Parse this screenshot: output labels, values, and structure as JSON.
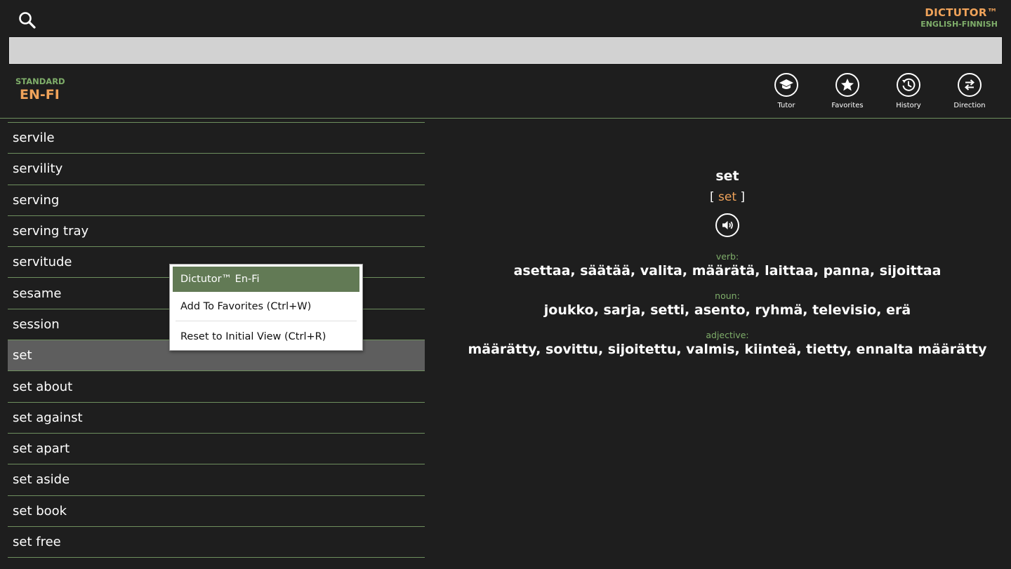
{
  "header": {
    "brand_name": "DICTUTOR™",
    "brand_sub": "ENGLISH-FINNISH",
    "search": {
      "value": "",
      "placeholder": ""
    },
    "mode_label": "STANDARD",
    "mode_value": "EN-FI"
  },
  "toolbar": [
    {
      "label": "Tutor",
      "icon": "graduation-cap-icon"
    },
    {
      "label": "Favorites",
      "icon": "star-icon"
    },
    {
      "label": "History",
      "icon": "clock-history-icon"
    },
    {
      "label": "Direction",
      "icon": "swap-arrows-icon"
    }
  ],
  "word_list": [
    "servile",
    "servility",
    "serving",
    "serving tray",
    "servitude",
    "sesame",
    "session",
    "set",
    "set about",
    "set against",
    "set apart",
    "set aside",
    "set book",
    "set free"
  ],
  "selected_word": "set",
  "entry": {
    "headword": "set",
    "pron_open": "[",
    "pron": "set",
    "pron_close": "]",
    "senses": [
      {
        "pos": "verb:",
        "translations": "asettaa, säätää, valita, määrätä, laittaa, panna, sijoittaa"
      },
      {
        "pos": "noun:",
        "translations": "joukko, sarja, setti, asento, ryhmä, televisio, erä"
      },
      {
        "pos": "adjective:",
        "translations": "määrätty, sovittu, sijoitettu, valmis, kiinteä, tietty, ennalta määrätty"
      }
    ]
  },
  "context_menu": {
    "items": [
      "Dictutor™ En-Fi",
      "Add To Favorites (Ctrl+W)",
      "Reset to Initial View (Ctrl+R)"
    ]
  },
  "colors": {
    "background": "#1e1e1e",
    "accent_orange": "#f0a35a",
    "accent_green": "#7fae6a",
    "divider": "#6e8f5e",
    "selected_row": "#5e5e5e",
    "menu_highlight": "#627a55"
  }
}
